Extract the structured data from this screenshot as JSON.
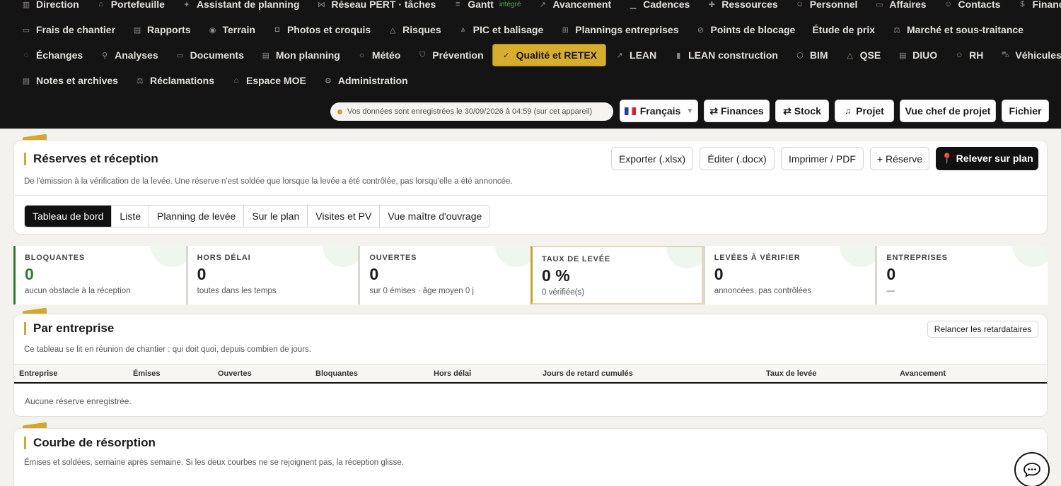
{
  "nav": {
    "row1": [
      {
        "icon": "direction-icon",
        "glyph": "▥",
        "label": "Direction"
      },
      {
        "icon": "portfolio-icon",
        "glyph": "⌂",
        "label": "Portefeuille"
      },
      {
        "icon": "sparkle-icon",
        "glyph": "✦",
        "label": "Assistant de planning"
      },
      {
        "icon": "network-icon",
        "glyph": "⋈",
        "label": "Réseau PERT · tâches"
      },
      {
        "icon": "gantt-icon",
        "glyph": "≡",
        "label": "Gantt",
        "badge": "intégré"
      },
      {
        "icon": "progress-icon",
        "glyph": "↗",
        "label": "Avancement"
      },
      {
        "icon": "cadence-icon",
        "glyph": "▁",
        "label": "Cadences"
      },
      {
        "icon": "resources-icon",
        "glyph": "✚",
        "label": "Ressources"
      },
      {
        "icon": "people-icon",
        "glyph": "☺",
        "label": "Personnel"
      },
      {
        "icon": "briefcase-icon",
        "glyph": "▭",
        "label": "Affaires"
      },
      {
        "icon": "contacts-icon",
        "glyph": "☺",
        "label": "Contacts"
      },
      {
        "icon": "dollar-icon",
        "glyph": "$",
        "label": "Finances"
      }
    ],
    "row2": [
      {
        "icon": "money-icon",
        "glyph": "▭",
        "label": "Frais de chantier"
      },
      {
        "icon": "report-icon",
        "glyph": "▤",
        "label": "Rapports"
      },
      {
        "icon": "pin-icon",
        "glyph": "◉",
        "label": "Terrain"
      },
      {
        "icon": "camera-icon",
        "glyph": "◘",
        "label": "Photos et croquis"
      },
      {
        "icon": "warning-icon",
        "glyph": "△",
        "label": "Risques"
      },
      {
        "icon": "cone-icon",
        "glyph": "⩓",
        "label": "PIC et balisage"
      },
      {
        "icon": "grid-icon",
        "glyph": "⊞",
        "label": "Plannings entreprises"
      },
      {
        "icon": "block-icon",
        "glyph": "⊘",
        "label": "Points de blocage"
      },
      {
        "icon": "none",
        "glyph": "",
        "label": "Étude de prix"
      },
      {
        "icon": "scale-icon",
        "glyph": "⚖",
        "label": "Marché et sous-traitance"
      }
    ],
    "row3": [
      {
        "icon": "chat-icon",
        "glyph": "◌",
        "label": "Échanges"
      },
      {
        "icon": "search-icon",
        "glyph": "⚲",
        "label": "Analyses"
      },
      {
        "icon": "folder-icon",
        "glyph": "▭",
        "label": "Documents"
      },
      {
        "icon": "calendar-icon",
        "glyph": "▤",
        "label": "Mon planning"
      },
      {
        "icon": "sun-icon",
        "glyph": "☼",
        "label": "Météo"
      },
      {
        "icon": "shield-icon",
        "glyph": "⛉",
        "label": "Prévention"
      },
      {
        "icon": "check-circle-icon",
        "glyph": "✓",
        "label": "Qualité et RETEX",
        "active": true
      },
      {
        "icon": "trend-icon",
        "glyph": "↗",
        "label": "LEAN"
      },
      {
        "icon": "bar-chart-icon",
        "glyph": "▮",
        "label": "LEAN construction"
      },
      {
        "icon": "cube-icon",
        "glyph": "⬡",
        "label": "BIM"
      },
      {
        "icon": "triangle-icon",
        "glyph": "△",
        "label": "QSE"
      },
      {
        "icon": "doc-icon",
        "glyph": "▤",
        "label": "DIUO"
      },
      {
        "icon": "user-plus-icon",
        "glyph": "☺",
        "label": "RH"
      },
      {
        "icon": "car-icon",
        "glyph": "⛍",
        "label": "Véhicules"
      }
    ],
    "row4": [
      {
        "icon": "note-icon",
        "glyph": "▤",
        "label": "Notes et archives"
      },
      {
        "icon": "scale-icon",
        "glyph": "⚖",
        "label": "Réclamations"
      },
      {
        "icon": "building-icon",
        "glyph": "⌂",
        "label": "Espace MOE"
      },
      {
        "icon": "gear-icon",
        "glyph": "⚙",
        "label": "Administration"
      }
    ]
  },
  "header": {
    "save_status": "Vos données sont enregistrées le 30/09/2026 à 04:59 (sur cet appareil)",
    "language": "Français",
    "buttons": {
      "finances": "⇄ Finances",
      "stock": "⇄ Stock",
      "project": "Projet",
      "manager_view": "Vue chef de projet",
      "file": "Fichier"
    }
  },
  "reserves": {
    "title": "Réserves et réception",
    "subtitle": "De l'émission à la vérification de la levée. Une réserve n'est soldée que lorsque la levée a été contrôlée, pas lorsqu'elle a été annoncée.",
    "actions": {
      "export": "Exporter (.xlsx)",
      "edit": "Éditer (.docx)",
      "print": "Imprimer / PDF",
      "add": "+ Réserve",
      "plan": "📍 Relever sur plan"
    },
    "tabs": [
      "Tableau de bord",
      "Liste",
      "Planning de levée",
      "Sur le plan",
      "Visites et PV",
      "Vue maître d'ouvrage"
    ]
  },
  "kpis": [
    {
      "label": "BLOQUANTES",
      "value": "0",
      "note": "aucun obstacle à la réception"
    },
    {
      "label": "HORS DÉLAI",
      "value": "0",
      "note": "toutes dans les temps"
    },
    {
      "label": "OUVERTES",
      "value": "0",
      "note": "sur 0 émises · âge moyen 0 j"
    },
    {
      "label": "TAUX DE LEVÉE",
      "value": "0 %",
      "note": "0 vérifiée(s)"
    },
    {
      "label": "LEVÉES À VÉRIFIER",
      "value": "0",
      "note": "annoncées, pas contrôlées"
    },
    {
      "label": "ENTREPRISES",
      "value": "0",
      "note": "—"
    }
  ],
  "by_company": {
    "title": "Par entreprise",
    "subtitle": "Ce tableau se lit en réunion de chantier : qui doit quoi, depuis combien de jours.",
    "remind_button": "Relancer les retardataires",
    "columns": [
      "Entreprise",
      "Émises",
      "Ouvertes",
      "Bloquantes",
      "Hors délai",
      "Jours de retard cumulés",
      "Taux de levée",
      "Avancement"
    ],
    "empty": "Aucune réserve enregistrée."
  },
  "curve": {
    "title": "Courbe de résorption",
    "subtitle": "Émises et soldées, semaine après semaine. Si les deux courbes ne se rejoignent pas, la réception glisse."
  },
  "colors": {
    "accent": "#d2a82a",
    "dark": "#141414",
    "green": "#2e7d32"
  }
}
